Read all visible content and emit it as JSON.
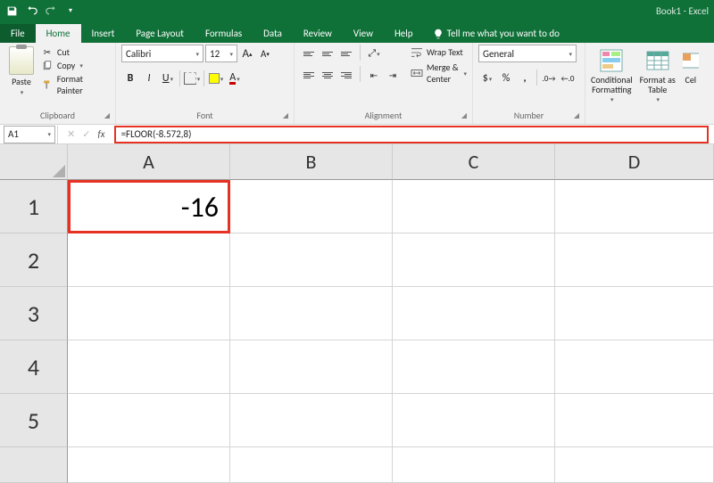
{
  "titlebar": {
    "app_title": "Book1 - Excel"
  },
  "tabs": {
    "file": "File",
    "home": "Home",
    "insert": "Insert",
    "page_layout": "Page Layout",
    "formulas": "Formulas",
    "data": "Data",
    "review": "Review",
    "view": "View",
    "help": "Help",
    "tellme": "Tell me what you want to do"
  },
  "ribbon": {
    "clipboard": {
      "label": "Clipboard",
      "paste": "Paste",
      "cut": "Cut",
      "copy": "Copy",
      "format_painter": "Format Painter"
    },
    "font": {
      "label": "Font",
      "name": "Calibri",
      "size": "12"
    },
    "alignment": {
      "label": "Alignment",
      "wrap": "Wrap Text",
      "merge": "Merge & Center"
    },
    "number": {
      "label": "Number",
      "format": "General"
    },
    "styles": {
      "cond": "Conditional\nFormatting",
      "table": "Format as\nTable",
      "cell": "Cel"
    }
  },
  "formula_bar": {
    "name_box": "A1",
    "formula": "=FLOOR(-8.572,8)"
  },
  "grid": {
    "columns": [
      "A",
      "B",
      "C",
      "D"
    ],
    "rows": [
      "1",
      "2",
      "3",
      "4",
      "5"
    ],
    "a1_value": "-16"
  },
  "chart_data": {
    "type": "table",
    "columns": [
      "A",
      "B",
      "C",
      "D"
    ],
    "rows": [
      [
        "-16",
        "",
        "",
        ""
      ],
      [
        "",
        "",
        "",
        ""
      ],
      [
        "",
        "",
        "",
        ""
      ],
      [
        "",
        "",
        "",
        ""
      ],
      [
        "",
        "",
        "",
        ""
      ]
    ],
    "active_cell": "A1",
    "formula": "=FLOOR(-8.572,8)"
  }
}
